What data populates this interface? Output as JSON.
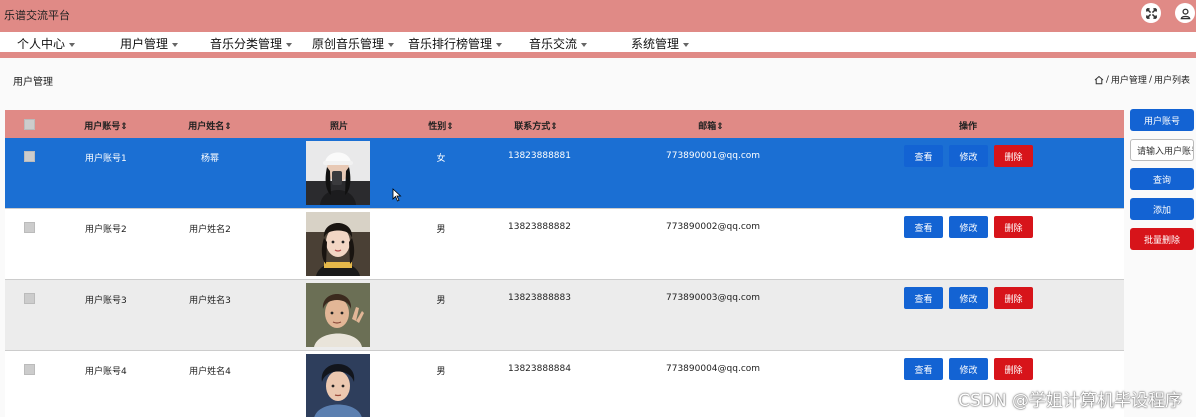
{
  "app": {
    "title": "乐谱交流平台"
  },
  "menu": [
    {
      "label": "个人中心"
    },
    {
      "label": "用户管理"
    },
    {
      "label": "音乐分类管理"
    },
    {
      "label": "原创音乐管理"
    },
    {
      "label": "音乐排行榜管理"
    },
    {
      "label": "音乐交流"
    },
    {
      "label": "系统管理"
    }
  ],
  "page": {
    "title": "用户管理",
    "breadcrumb": {
      "section": "用户管理",
      "current": "用户列表"
    }
  },
  "table": {
    "headers": [
      "用户账号",
      "用户姓名",
      "照片",
      "性别",
      "联系方式",
      "邮箱",
      "操作"
    ],
    "rows": [
      {
        "account": "用户账号1",
        "name": "杨幂",
        "gender": "女",
        "phone": "13823888881",
        "email": "773890001@qq.com"
      },
      {
        "account": "用户账号2",
        "name": "用户姓名2",
        "gender": "男",
        "phone": "13823888882",
        "email": "773890002@qq.com"
      },
      {
        "account": "用户账号3",
        "name": "用户姓名3",
        "gender": "男",
        "phone": "13823888883",
        "email": "773890003@qq.com"
      },
      {
        "account": "用户账号4",
        "name": "用户姓名4",
        "gender": "男",
        "phone": "13823888884",
        "email": "773890004@qq.com"
      }
    ],
    "actions": {
      "view": "查看",
      "edit": "修改",
      "delete": "删除"
    }
  },
  "side": {
    "account_label": "用户账号",
    "search_placeholder": "请输入用户账号",
    "search": "查询",
    "add": "添加",
    "batch_delete": "批量删除"
  },
  "watermark": "CSDN @学姐计算机毕设程序",
  "colors": {
    "header": "#e08a86",
    "primary": "#1363d3",
    "danger": "#d7141a",
    "selected_row": "#1b6fd3"
  }
}
